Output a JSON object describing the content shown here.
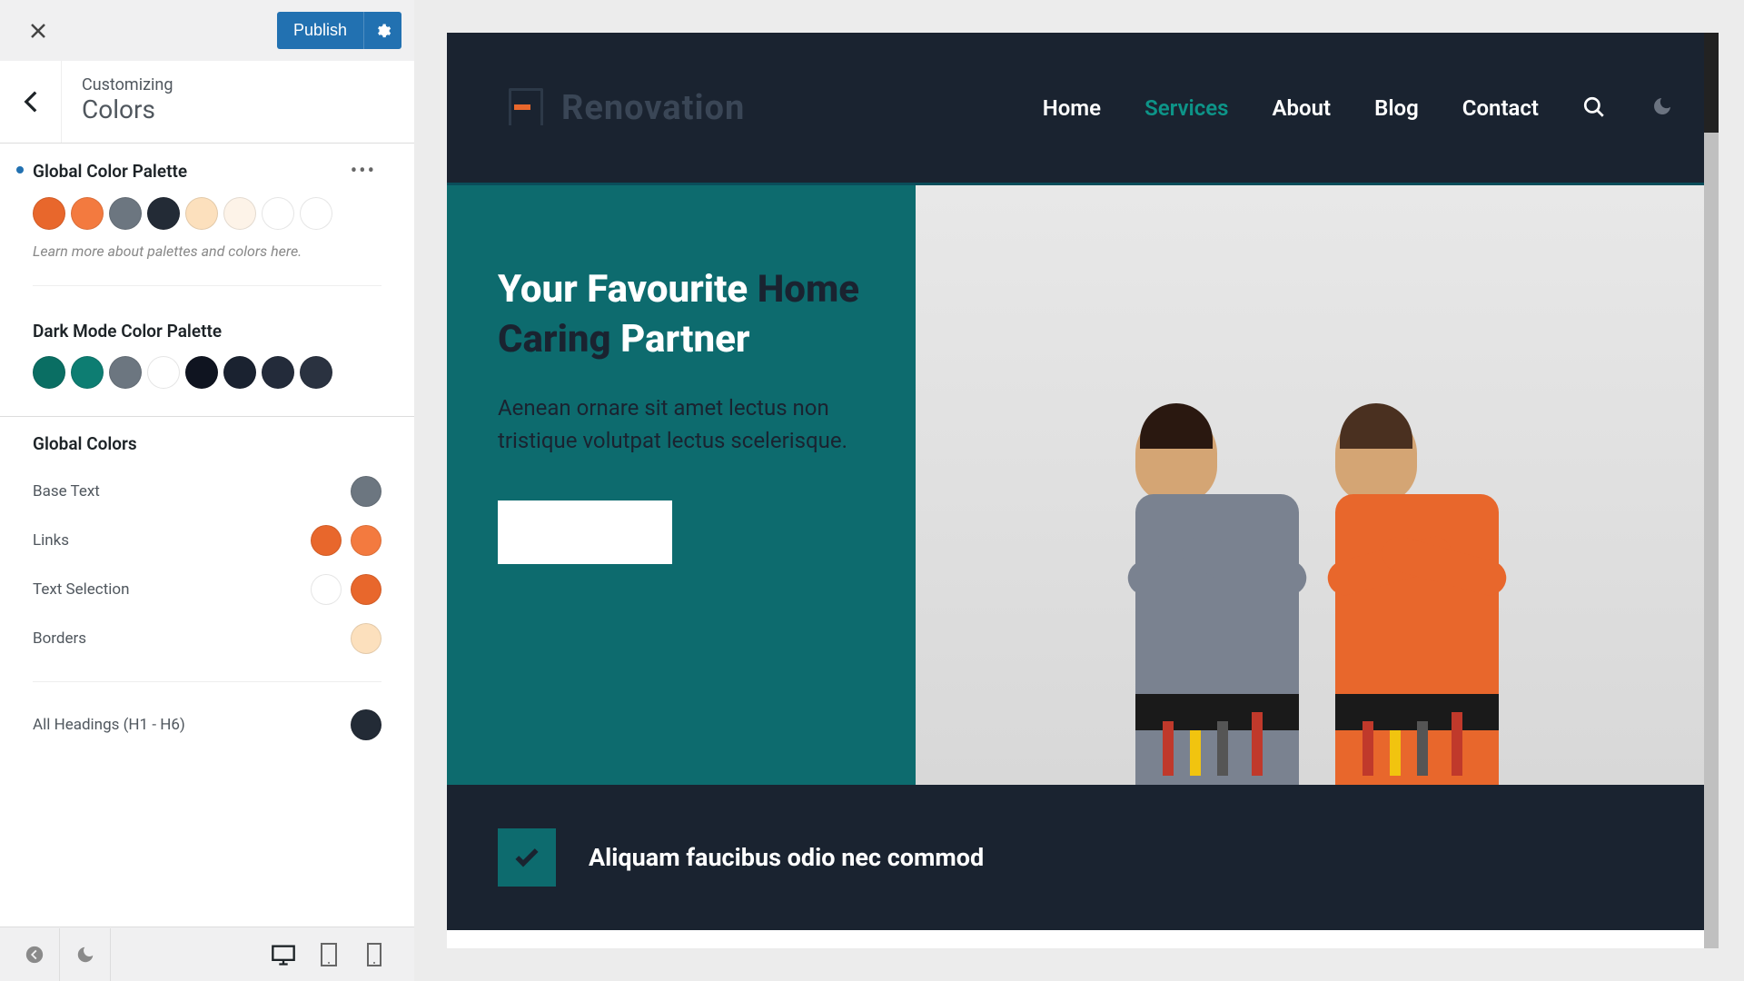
{
  "header": {
    "publish_label": "Publish"
  },
  "panel": {
    "breadcrumb": "Customizing",
    "title": "Colors"
  },
  "global_palette": {
    "title": "Global Color Palette",
    "hint": "Learn more about palettes and colors here.",
    "colors": [
      "#e8672c",
      "#f37a3f",
      "#6c7680",
      "#232b36",
      "#fce0bd",
      "#fdf3e8",
      "#ffffff",
      "#ffffff"
    ]
  },
  "dark_palette": {
    "title": "Dark Mode Color Palette",
    "colors": [
      "#0a6e63",
      "#0d7d72",
      "#6c7680",
      "#ffffff",
      "#0f1420",
      "#1a2230",
      "#232b3a",
      "#2a3240"
    ]
  },
  "global_colors": {
    "title": "Global Colors",
    "items": [
      {
        "label": "Base Text",
        "swatches": [
          "#6c7680"
        ]
      },
      {
        "label": "Links",
        "swatches": [
          "#e8672c",
          "#f37a3f"
        ]
      },
      {
        "label": "Text Selection",
        "swatches": [
          "#ffffff",
          "#e8672c"
        ]
      },
      {
        "label": "Borders",
        "swatches": [
          "#fce0bd"
        ]
      },
      {
        "label": "All Headings (H1 - H6)",
        "swatches": [
          "#232b36"
        ]
      }
    ]
  },
  "preview": {
    "brand": "Renovation",
    "nav": [
      "Home",
      "Services",
      "About",
      "Blog",
      "Contact"
    ],
    "active_nav_index": 1,
    "hero": {
      "title_before": "Your Favourite ",
      "title_accent": "Home Caring",
      "title_after": " Partner",
      "text": "Aenean ornare sit amet lectus non tristique volutpat lectus scelerisque."
    },
    "feature_text": "Aliquam faucibus odio nec commod"
  }
}
